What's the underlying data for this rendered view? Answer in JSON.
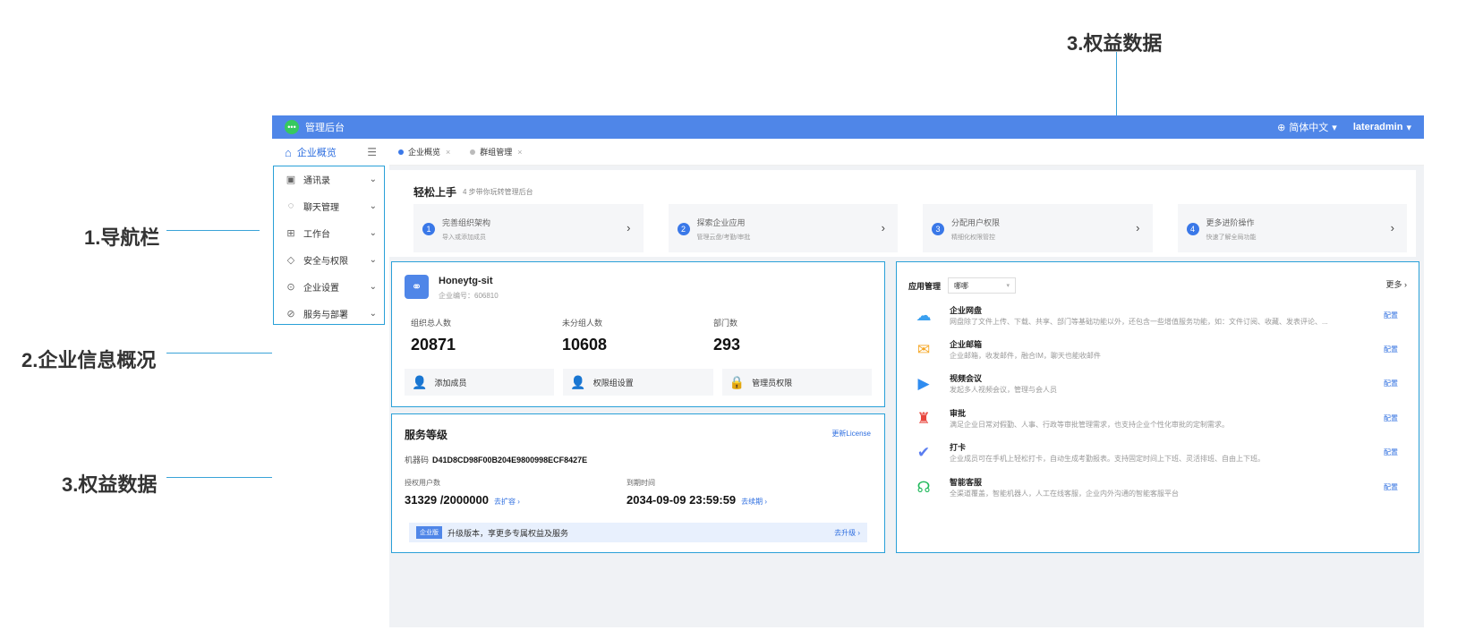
{
  "callouts": {
    "nav": "1.导航栏",
    "company": "2.企业信息概况",
    "rights_left": "3.权益数据",
    "rights_top": "3.权益数据"
  },
  "topbar": {
    "title": "管理后台",
    "language": "简体中文",
    "user": "lateradmin"
  },
  "sidebar": {
    "overview": "企业概览",
    "items": [
      {
        "label": "通讯录",
        "icon": "contacts-icon"
      },
      {
        "label": "聊天管理",
        "icon": "chat-icon"
      },
      {
        "label": "工作台",
        "icon": "grid-icon"
      },
      {
        "label": "安全与权限",
        "icon": "shield-icon"
      },
      {
        "label": "企业设置",
        "icon": "settings-icon"
      },
      {
        "label": "服务与部署",
        "icon": "compass-icon"
      }
    ]
  },
  "tabs": [
    {
      "label": "企业概览",
      "active": true
    },
    {
      "label": "群组管理",
      "active": false
    }
  ],
  "guide": {
    "title": "轻松上手",
    "subtitle": "4 步带你玩转管理后台",
    "steps": [
      {
        "num": "1",
        "title": "完善组织架构",
        "desc": "导入或添加成员"
      },
      {
        "num": "2",
        "title": "探索企业应用",
        "desc": "管理云盘/考勤/审批"
      },
      {
        "num": "3",
        "title": "分配用户权限",
        "desc": "精细化权限管控"
      },
      {
        "num": "4",
        "title": "更多进阶操作",
        "desc": "快速了解全局功能"
      }
    ]
  },
  "company": {
    "name": "Honeytg-sit",
    "id_label": "企业编号：606810",
    "stats": [
      {
        "label": "组织总人数",
        "value": "20871"
      },
      {
        "label": "未分组人数",
        "value": "10608"
      },
      {
        "label": "部门数",
        "value": "293"
      }
    ],
    "actions": [
      {
        "label": "添加成员"
      },
      {
        "label": "权限组设置"
      },
      {
        "label": "管理员权限"
      }
    ]
  },
  "service": {
    "title": "服务等级",
    "license_link": "更新License",
    "machine_label": "机器码",
    "machine_code": "D41D8CD98F00B204E9800998ECF8427E",
    "users_label": "授权用户数",
    "users_value": "31329 /2000000",
    "users_link": "去扩容 ›",
    "expire_label": "到期时间",
    "expire_value": "2034-09-09 23:59:59",
    "expire_link": "去续期 ›",
    "upgrade_badge": "企业版",
    "upgrade_text": "升级版本，享更多专属权益及服务",
    "upgrade_link": "去升级 ›"
  },
  "apps": {
    "title": "应用管理",
    "select_value": "哪哪",
    "more": "更多 ›",
    "configure": "配置",
    "rows": [
      {
        "name": "企业网盘",
        "desc": "网盘除了文件上传、下载、共享、部门等基础功能以外，还包含一些增值服务功能，如：文件订阅、收藏、发表评论、...",
        "icon": "cloud-icon",
        "color": "#3aa0f0"
      },
      {
        "name": "企业邮箱",
        "desc": "企业邮箱，收发邮件，融合IM，聊天也能收邮件",
        "icon": "mail-icon",
        "color": "#f5a623"
      },
      {
        "name": "视频会议",
        "desc": "发起多人视频会议，管理与会人员",
        "icon": "video-icon",
        "color": "#2f8cf0"
      },
      {
        "name": "审批",
        "desc": "满足企业日常对假勤、人事、行政等审批管理需求，也支持企业个性化审批的定制需求。",
        "icon": "stamp-icon",
        "color": "#e8453c"
      },
      {
        "name": "打卡",
        "desc": "企业成员可在手机上轻松打卡，自动生成考勤报表。支持固定时间上下班、灵活排班、自由上下班。",
        "icon": "checkin-icon",
        "color": "#5a7df0"
      },
      {
        "name": "智能客服",
        "desc": "全渠道覆盖，智能机器人，人工在线客服，企业内外沟通的智能客服平台",
        "icon": "headset-icon",
        "color": "#1fb85a"
      }
    ]
  }
}
